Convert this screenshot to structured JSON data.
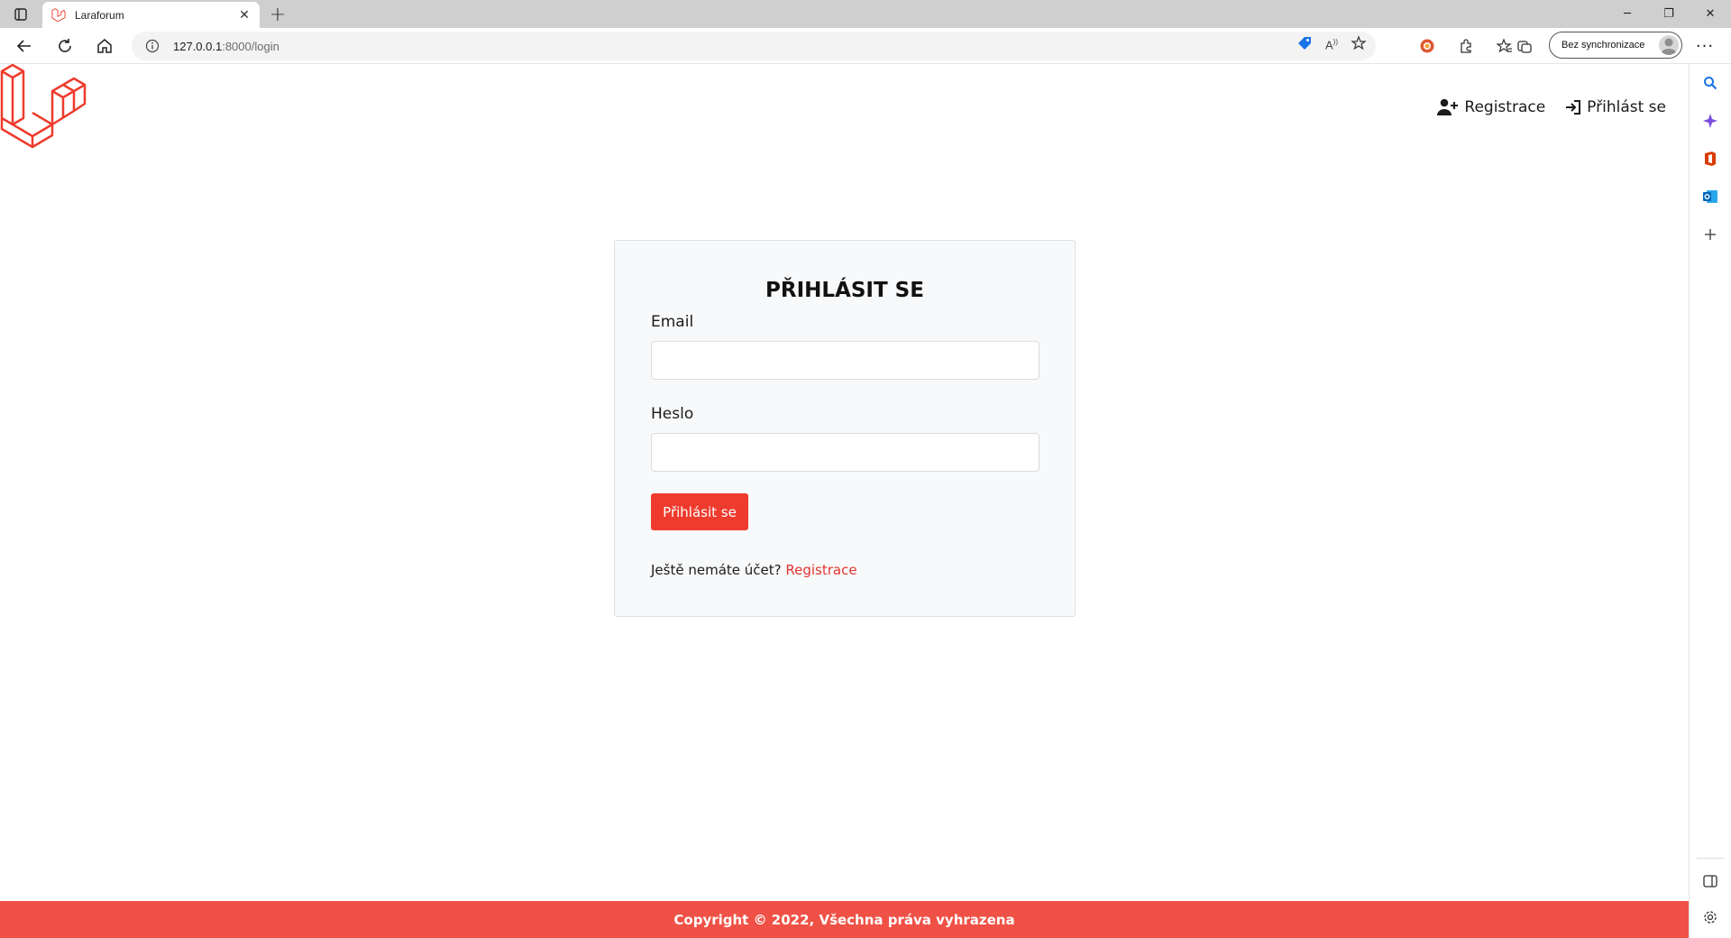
{
  "browser": {
    "tab_title": "Laraforum",
    "tab_close": "✕",
    "new_tab": "+",
    "url_host": "127.0.0.1",
    "url_rest": ":8000/login",
    "profile_label": "Bez synchronizace",
    "window_controls": [
      "─",
      "❐",
      "✕"
    ]
  },
  "page": {
    "nav": {
      "register_label": "Registrace",
      "login_label": "Přihlást se"
    },
    "login_card": {
      "title": "PŘIHLÁSIT SE",
      "email_label": "Email",
      "email_value": "",
      "password_label": "Heslo",
      "password_value": "",
      "submit_label": "Přihlásit se",
      "no_account_text": "Ještě nemáte účet?",
      "register_link": "Registrace"
    },
    "footer_text": "Copyright © 2022, Všechna práva vyhrazena"
  },
  "colors": {
    "brand_red": "#ef3b2d",
    "footer_red": "#f05146",
    "link_red": "#e3342f"
  }
}
